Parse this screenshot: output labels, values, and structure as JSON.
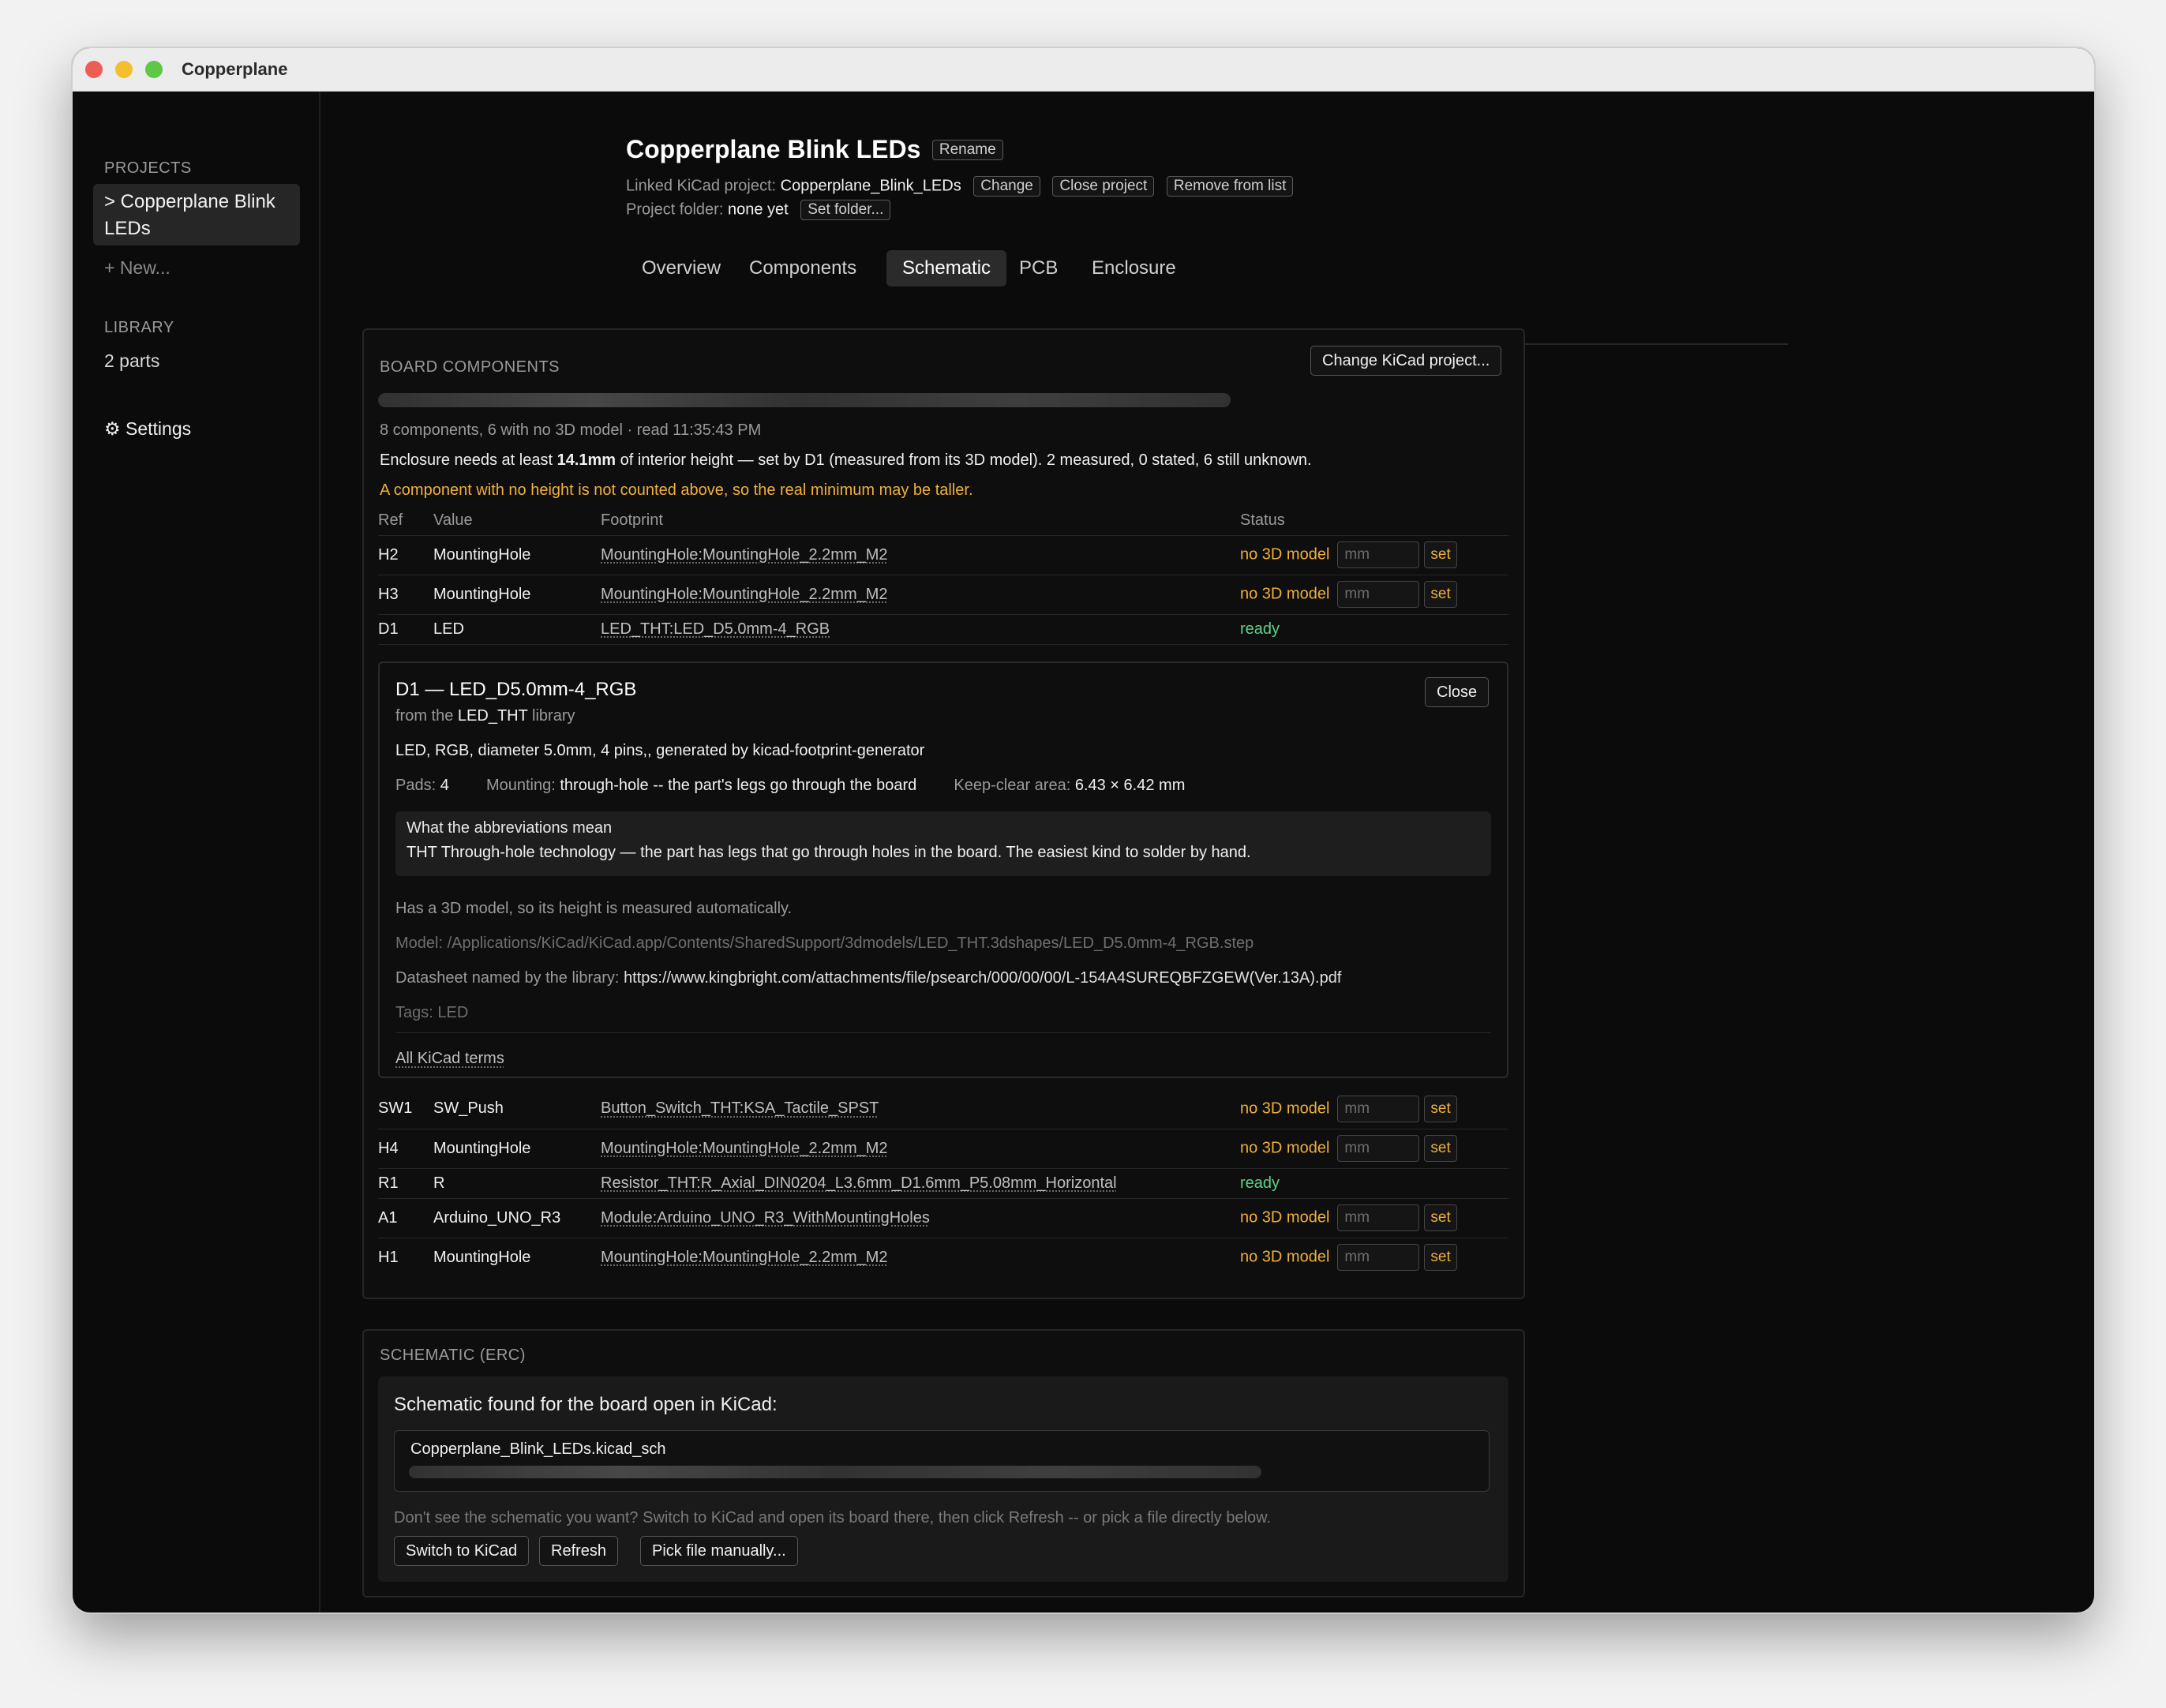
{
  "window": {
    "title": "Copperplane"
  },
  "sidebar": {
    "projects_heading": "PROJECTS",
    "active_project": "> Copperplane Blink LEDs",
    "new_link": "+ New...",
    "library_heading": "LIBRARY",
    "library_count": "2 parts",
    "settings": "⚙ Settings"
  },
  "header": {
    "title": "Copperplane Blink LEDs",
    "rename": "Rename",
    "linked_label": "Linked KiCad project:",
    "linked_value": "Copperplane_Blink_LEDs",
    "change": "Change",
    "close_project": "Close project",
    "remove": "Remove from list",
    "folder_label": "Project folder:",
    "folder_value": "none yet",
    "set_folder": "Set folder..."
  },
  "tabs": [
    "Overview",
    "Components",
    "Schematic",
    "PCB",
    "Enclosure"
  ],
  "active_tab": "Schematic",
  "board": {
    "heading": "BOARD COMPONENTS",
    "change_btn": "Change KiCad project...",
    "summary": "8 components, 6 with no 3D model · read 11:35:43 PM",
    "height_pre": "Enclosure needs at least",
    "height_value": "14.1mm",
    "height_post": "of interior height — set by D1 (measured from its 3D model). 2 measured, 0 stated, 6 still unknown.",
    "warning": "A component with no height is not counted above, so the real minimum may be taller.",
    "columns": {
      "ref": "Ref",
      "value": "Value",
      "footprint": "Footprint",
      "status": "Status"
    },
    "rows_top": [
      {
        "ref": "H2",
        "value": "MountingHole",
        "footprint": "MountingHole:MountingHole_2.2mm_M2",
        "status": "no 3D model"
      },
      {
        "ref": "H3",
        "value": "MountingHole",
        "footprint": "MountingHole:MountingHole_2.2mm_M2",
        "status": "no 3D model"
      },
      {
        "ref": "D1",
        "value": "LED",
        "footprint": "LED_THT:LED_D5.0mm-4_RGB",
        "status": "ready"
      }
    ],
    "rows_bottom": [
      {
        "ref": "SW1",
        "value": "SW_Push",
        "footprint": "Button_Switch_THT:KSA_Tactile_SPST",
        "status": "no 3D model"
      },
      {
        "ref": "H4",
        "value": "MountingHole",
        "footprint": "MountingHole:MountingHole_2.2mm_M2",
        "status": "no 3D model"
      },
      {
        "ref": "R1",
        "value": "R",
        "footprint": "Resistor_THT:R_Axial_DIN0204_L3.6mm_D1.6mm_P5.08mm_Horizontal",
        "status": "ready"
      },
      {
        "ref": "A1",
        "value": "Arduino_UNO_R3",
        "footprint": "Module:Arduino_UNO_R3_WithMountingHoles",
        "status": "no 3D model"
      },
      {
        "ref": "H1",
        "value": "MountingHole",
        "footprint": "MountingHole:MountingHole_2.2mm_M2",
        "status": "no 3D model"
      }
    ],
    "mm_placeholder": "mm",
    "set_label": "set"
  },
  "detail": {
    "title": "D1 — LED_D5.0mm-4_RGB",
    "lib_pre": "from the",
    "lib_name": "LED_THT",
    "lib_post": "library",
    "close": "Close",
    "description": "LED, RGB, diameter 5.0mm, 4 pins,, generated by kicad-footprint-generator",
    "pads_label": "Pads:",
    "pads_value": "4",
    "mounting_label": "Mounting:",
    "mounting_value": "through-hole -- the part's legs go through the board",
    "keepclear_label": "Keep-clear area:",
    "keepclear_value": "6.43 × 6.42 mm",
    "abbr_heading": "What the abbreviations mean",
    "abbr_term": "THT",
    "abbr_text": "Through-hole technology — the part has legs that go through holes in the board. The easiest kind to solder by hand.",
    "has_model": "Has a 3D model, so its height is measured automatically.",
    "model_path": "Model: /Applications/KiCad/KiCad.app/Contents/SharedSupport/3dmodels/LED_THT.3dshapes/LED_D5.0mm-4_RGB.step",
    "datasheet_label": "Datasheet named by the library:",
    "datasheet_url": "https://www.kingbright.com/attachments/file/psearch/000/00/00/L-154A4SUREQBFZGEW(Ver.13A).pdf",
    "tags": "Tags: LED",
    "all_terms": "All KiCad terms"
  },
  "erc": {
    "heading": "SCHEMATIC (ERC)",
    "found": "Schematic found for the board open in KiCad:",
    "file": "Copperplane_Blink_LEDs.kicad_sch",
    "hint": "Don't see the schematic you want? Switch to KiCad and open its board there, then click Refresh -- or pick a file directly below.",
    "switch": "Switch to KiCad",
    "refresh": "Refresh",
    "pick": "Pick file manually..."
  },
  "colors": {
    "warning": "#f0b03a",
    "ready": "#5fd18c",
    "background": "#0b0b0b"
  }
}
